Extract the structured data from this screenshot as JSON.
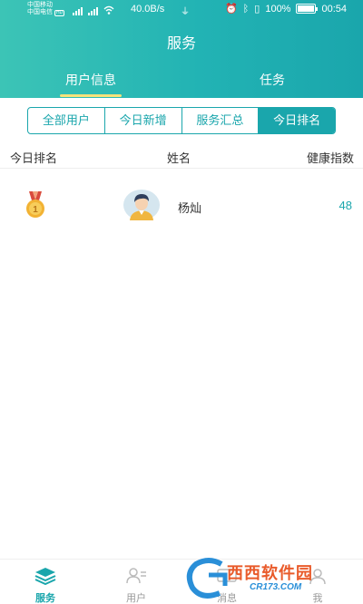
{
  "status_bar": {
    "carrier1": "中国移动",
    "carrier2": "中国电信",
    "hd": "HD",
    "speed": "40.0B/s",
    "battery": "100%",
    "battery_level": 1.0,
    "time": "00:54"
  },
  "header": {
    "title": "服务",
    "tabs": [
      {
        "label": "用户信息",
        "active": true
      },
      {
        "label": "任务",
        "active": false
      }
    ]
  },
  "segments": [
    {
      "label": "全部用户",
      "active": false
    },
    {
      "label": "今日新增",
      "active": false
    },
    {
      "label": "服务汇总",
      "active": false
    },
    {
      "label": "今日排名",
      "active": true
    }
  ],
  "table": {
    "columns": [
      "今日排名",
      "姓名",
      "健康指数"
    ],
    "rows": [
      {
        "rank": "1",
        "name": "杨灿",
        "score": "48"
      }
    ]
  },
  "bottom_nav": [
    {
      "label": "服务",
      "icon": "layers-icon",
      "active": true
    },
    {
      "label": "用户",
      "icon": "user-list-icon",
      "active": false
    },
    {
      "label": "消息",
      "icon": "message-icon",
      "active": false
    },
    {
      "label": "我",
      "icon": "profile-icon",
      "active": false
    }
  ],
  "watermark": {
    "text": "西西软件园",
    "sub": "CR173.COM"
  },
  "colors": {
    "primary": "#1aa6ac",
    "header_start": "#3cc4b6",
    "tab_indicator": "#f7e27a",
    "medal_gold": "#f2b233"
  }
}
